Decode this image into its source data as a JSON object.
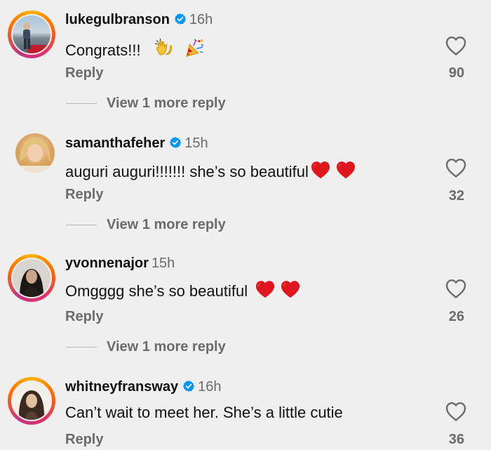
{
  "comments": [
    {
      "username": "lukegulbranson",
      "verified": true,
      "time": "16h",
      "text": "Congrats!!!",
      "emojis": [
        "clapping-hands-emoji",
        "party-popper-emoji"
      ],
      "reply_label": "Reply",
      "likes": "90",
      "view_more": "View 1 more reply",
      "story_ring": true
    },
    {
      "username": "samanthafeher",
      "verified": true,
      "time": "15h",
      "text": "auguri auguri!!!!!!! she’s so beautiful",
      "emojis": [
        "red-heart-emoji",
        "red-heart-emoji"
      ],
      "reply_label": "Reply",
      "likes": "32",
      "view_more": "View 1 more reply",
      "story_ring": false
    },
    {
      "username": "yvonnenajor",
      "verified": false,
      "time": "15h",
      "text": "Omgggg she’s so beautiful",
      "emojis": [
        "red-heart-emoji",
        "red-heart-emoji"
      ],
      "reply_label": "Reply",
      "likes": "26",
      "view_more": "View 1 more reply",
      "story_ring": true
    },
    {
      "username": "whitneyfransway",
      "verified": true,
      "time": "16h",
      "text": "Can’t wait to meet her. She’s a little cutie",
      "emojis": [],
      "reply_label": "Reply",
      "likes": "36",
      "story_ring": true
    }
  ],
  "colors": {
    "background": "#efefef",
    "secondary_text": "#6b6b6b",
    "verified_blue": "#0095f6",
    "heart_red": "#e0161e"
  }
}
